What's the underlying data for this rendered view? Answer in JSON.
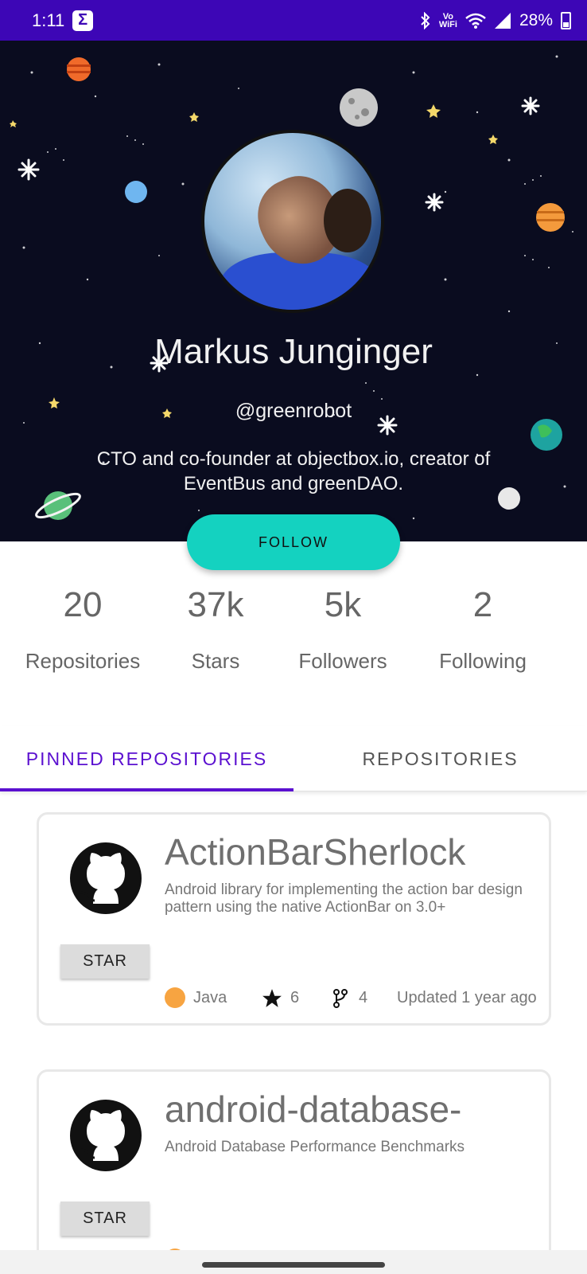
{
  "status_bar": {
    "time": "1:11",
    "app_icon_letter": "Σ",
    "wifi_label_top": "Vo",
    "wifi_label_bottom": "WiFi",
    "battery": "28%"
  },
  "profile": {
    "name": "Markus Junginger",
    "handle": "@greenrobot",
    "bio": "CTO and co-founder at objectbox.io, creator of EventBus and greenDAO."
  },
  "follow_label": "FOLLOW",
  "stats": [
    {
      "value": "20",
      "label": "Repositories"
    },
    {
      "value": "37k",
      "label": "Stars"
    },
    {
      "value": "5k",
      "label": "Followers"
    },
    {
      "value": "2",
      "label": "Following"
    }
  ],
  "tabs": {
    "pinned": "PINNED REPOSITORIES",
    "repositories": "REPOSITORIES"
  },
  "repos": [
    {
      "name": "ActionBarSherlock",
      "description": "Android library for implementing the action bar design pattern using the native ActionBar on 3.0+",
      "star_label": "STAR",
      "language": "Java",
      "stars": "6",
      "forks": "4",
      "updated": "Updated 1 year ago"
    },
    {
      "name": "android-database-",
      "description": "Android Database Performance Benchmarks",
      "star_label": "STAR"
    }
  ],
  "colors": {
    "status_bar": "#3d06b6",
    "accent": "#5b10d0",
    "follow_button": "#14d2c0",
    "language_dot": "#f7a441"
  }
}
